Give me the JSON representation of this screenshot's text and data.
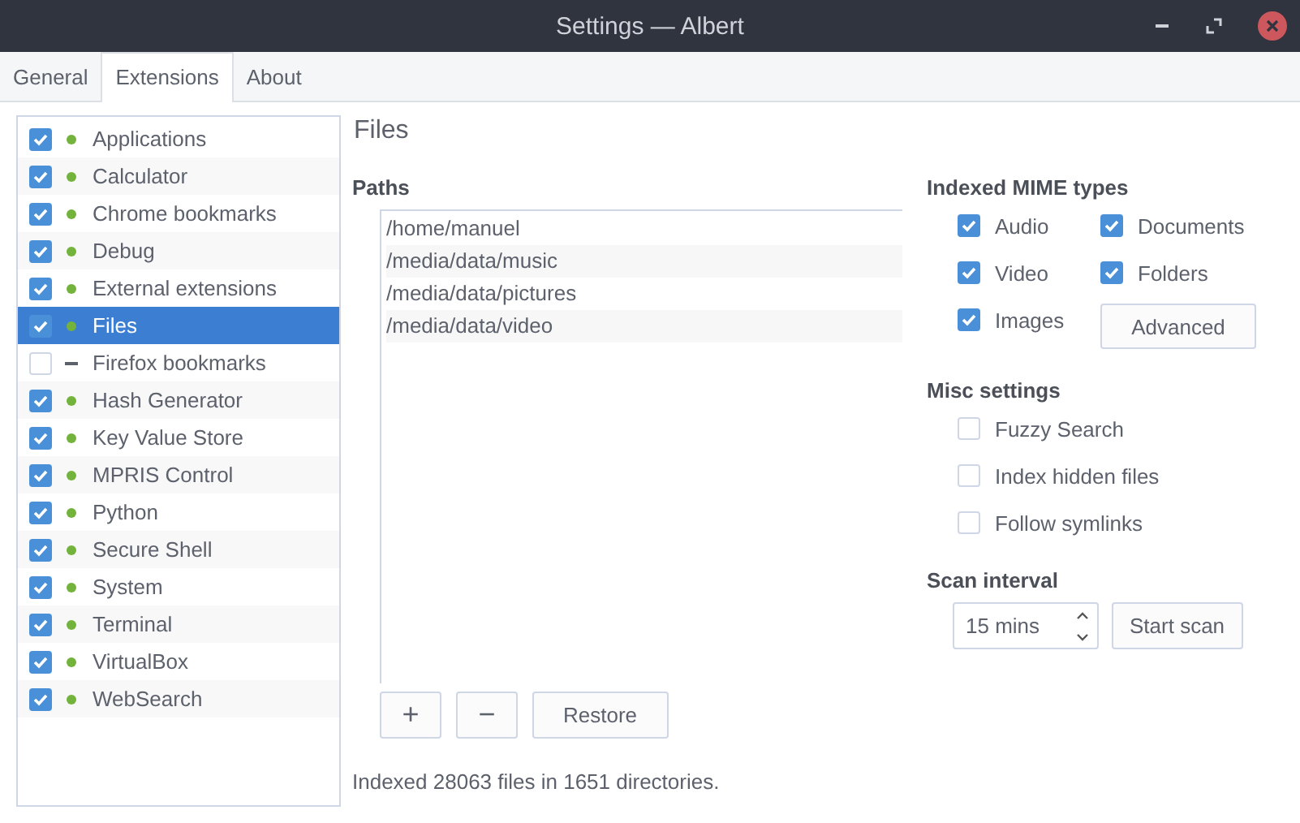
{
  "window": {
    "title": "Settings — Albert"
  },
  "tabs": [
    {
      "label": "General",
      "selected": false
    },
    {
      "label": "Extensions",
      "selected": true
    },
    {
      "label": "About",
      "selected": false
    }
  ],
  "extensions": [
    {
      "name": "Applications",
      "checked": true,
      "loaded": true,
      "selected": false
    },
    {
      "name": "Calculator",
      "checked": true,
      "loaded": true,
      "selected": false
    },
    {
      "name": "Chrome bookmarks",
      "checked": true,
      "loaded": true,
      "selected": false
    },
    {
      "name": "Debug",
      "checked": true,
      "loaded": true,
      "selected": false
    },
    {
      "name": "External extensions",
      "checked": true,
      "loaded": true,
      "selected": false
    },
    {
      "name": "Files",
      "checked": true,
      "loaded": true,
      "selected": true
    },
    {
      "name": "Firefox bookmarks",
      "checked": false,
      "loaded": false,
      "selected": false
    },
    {
      "name": "Hash Generator",
      "checked": true,
      "loaded": true,
      "selected": false
    },
    {
      "name": "Key Value Store",
      "checked": true,
      "loaded": true,
      "selected": false
    },
    {
      "name": "MPRIS Control",
      "checked": true,
      "loaded": true,
      "selected": false
    },
    {
      "name": "Python",
      "checked": true,
      "loaded": true,
      "selected": false
    },
    {
      "name": "Secure Shell",
      "checked": true,
      "loaded": true,
      "selected": false
    },
    {
      "name": "System",
      "checked": true,
      "loaded": true,
      "selected": false
    },
    {
      "name": "Terminal",
      "checked": true,
      "loaded": true,
      "selected": false
    },
    {
      "name": "VirtualBox",
      "checked": true,
      "loaded": true,
      "selected": false
    },
    {
      "name": "WebSearch",
      "checked": true,
      "loaded": true,
      "selected": false
    }
  ],
  "panel": {
    "title": "Files",
    "paths_label": "Paths",
    "paths": [
      "/home/manuel",
      "/media/data/music",
      "/media/data/pictures",
      "/media/data/video"
    ],
    "path_buttons": [
      "+",
      "−",
      "Restore"
    ],
    "status": "Indexed 28063 files in 1651 directories.",
    "mime_label": "Indexed MIME types",
    "mime_types": [
      {
        "label": "Audio",
        "checked": true
      },
      {
        "label": "Documents",
        "checked": true
      },
      {
        "label": "Video",
        "checked": true
      },
      {
        "label": "Folders",
        "checked": true
      },
      {
        "label": "Images",
        "checked": true
      }
    ],
    "advanced_button": "Advanced",
    "misc_label": "Misc settings",
    "misc": [
      {
        "label": "Fuzzy Search",
        "checked": false
      },
      {
        "label": "Index hidden files",
        "checked": false
      },
      {
        "label": "Follow symlinks",
        "checked": false
      }
    ],
    "scan_label": "Scan interval",
    "scan_interval": "15 mins",
    "scan_button": "Start scan"
  }
}
